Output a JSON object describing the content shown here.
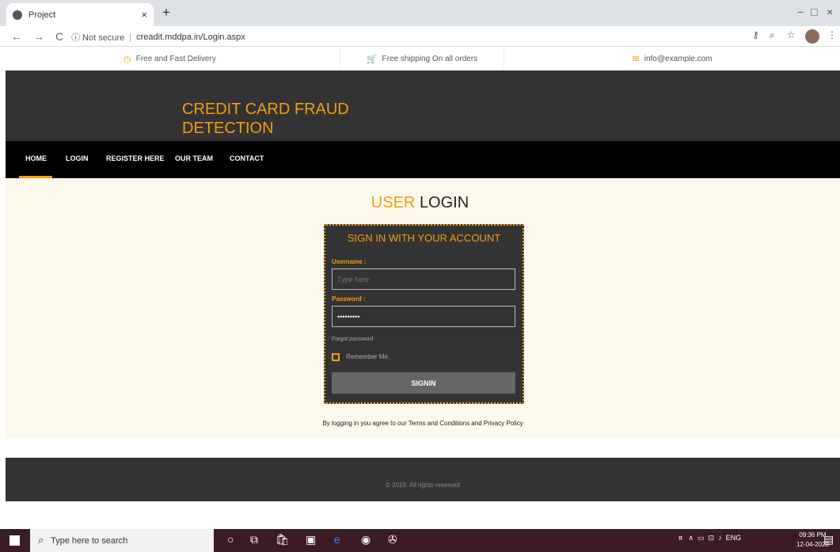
{
  "browser": {
    "tab_title": "Project",
    "tab_close": "×",
    "new_tab": "+",
    "back": "←",
    "forward": "→",
    "reload": "C",
    "security_label": "ⓘ Not secure",
    "separator": "|",
    "url": "creadit.mddpa.in/Login.aspx",
    "win_minimize": "−",
    "win_restore": "□",
    "win_close": "×"
  },
  "infobar": {
    "items": [
      {
        "icon": "clock-icon",
        "label": "Free and Fast Delivery"
      },
      {
        "icon": "cart-icon",
        "label": "Free shipping On all orders"
      },
      {
        "icon": "mail-icon",
        "label": "info@example.com"
      }
    ]
  },
  "site": {
    "title_line1": "CREDIT CARD FRAUD",
    "title_line2": "DETECTION"
  },
  "nav": {
    "items": [
      "HOME",
      "LOGIN",
      "REGISTER HERE",
      "OUR TEAM",
      "CONTACT"
    ],
    "active": "HOME"
  },
  "login": {
    "page_title_accent": "USER",
    "page_title_rest": "LOGIN",
    "box_title": "SIGN IN WITH YOUR ACCOUNT",
    "username_label": "Username :",
    "username_placeholder": "Type here",
    "password_label": "Password :",
    "password_value": "•••••••••",
    "forgot": "Forgot password",
    "remember": "Remember Me.",
    "signin": "SIGNIN",
    "terms": "By logging in you agree to our Terms and Conditions and Privacy Policy"
  },
  "footer": {
    "copyright": "© 2019. All rights reserved"
  },
  "taskbar": {
    "search_placeholder": "Type here to search",
    "language": "ENG",
    "time": "09:36 PM",
    "date": "12-04-2020"
  },
  "colors": {
    "accent": "#f39c12",
    "header_bg": "#333333",
    "nav_bg": "#000000",
    "main_bg": "#fdf8ec",
    "taskbar_bg": "#3b1b24"
  }
}
